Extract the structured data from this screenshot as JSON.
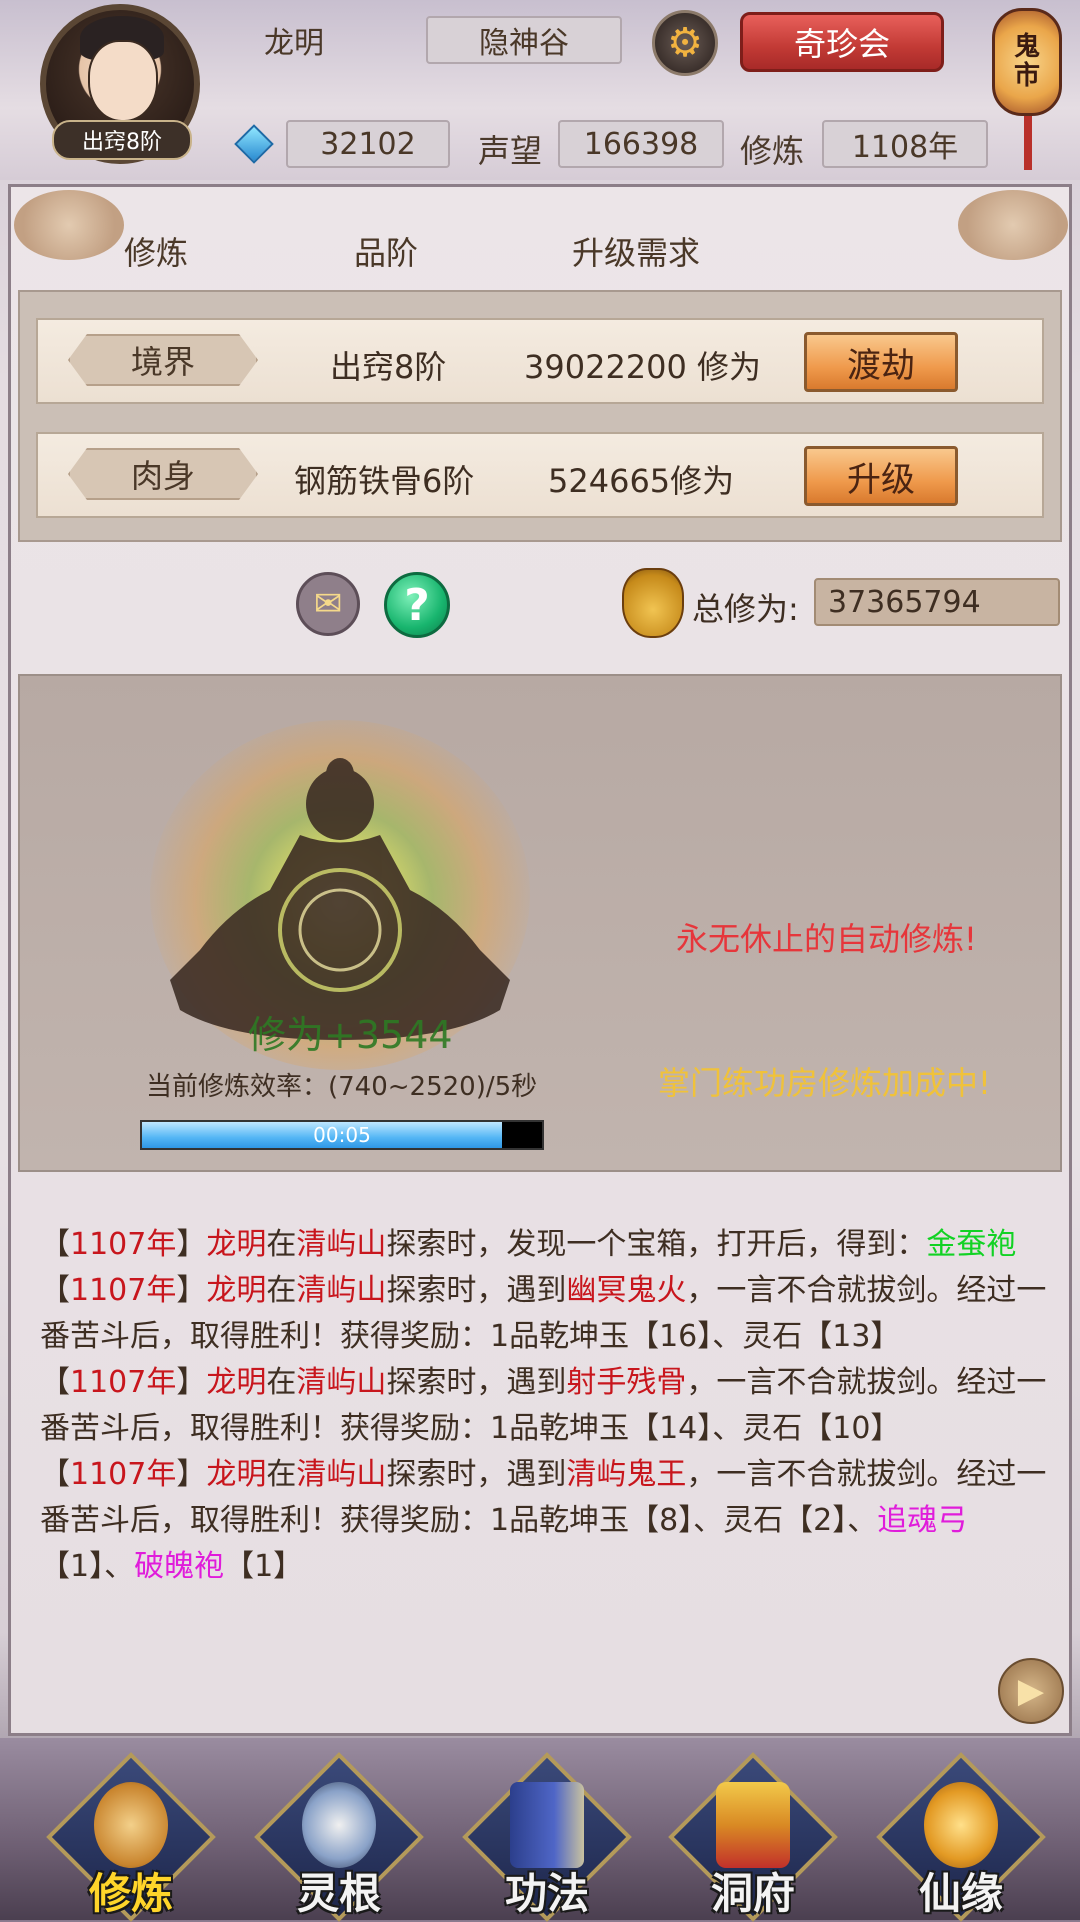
{
  "player": {
    "name": "龙明",
    "realm_badge": "出窍8阶",
    "location": "隐神谷",
    "gems": "32102",
    "fame_label": "声望",
    "fame": "166398",
    "cultivation_label": "修炼",
    "cultivation_years": "1108年"
  },
  "header": {
    "treasure_button": "奇珍会",
    "ghost_market": [
      "鬼",
      "市"
    ]
  },
  "table": {
    "columns": [
      "修炼",
      "品阶",
      "升级需求"
    ],
    "rows": [
      {
        "tag": "境界",
        "level": "出窍8阶",
        "requirement": "39022200 修为",
        "button": "渡劫"
      },
      {
        "tag": "肉身",
        "level": "钢筋铁骨6阶",
        "requirement": "524665修为",
        "button": "升级"
      }
    ]
  },
  "total": {
    "label": "总修为:",
    "value": "37365794"
  },
  "cultivation": {
    "gain_text": "修为+3544",
    "rate_text": "当前修炼效率：(740~2520)/5秒",
    "timer": "00:05",
    "progress": 0.9,
    "auto_text": "永无休止的自动修炼!",
    "sect_text": "掌门练功房修炼加成中!"
  },
  "log": [
    [
      {
        "t": "【",
        "c": ""
      },
      {
        "t": "1107年",
        "c": "red"
      },
      {
        "t": "】",
        "c": ""
      },
      {
        "t": "龙明",
        "c": "red"
      },
      {
        "t": "在",
        "c": ""
      },
      {
        "t": "清屿山",
        "c": "red"
      },
      {
        "t": "探索时，发现一个宝箱，打开后，得到：",
        "c": ""
      },
      {
        "t": "金蚕袍",
        "c": "green"
      }
    ],
    [
      {
        "t": "【",
        "c": ""
      },
      {
        "t": "1107年",
        "c": "red"
      },
      {
        "t": "】",
        "c": ""
      },
      {
        "t": "龙明",
        "c": "red"
      },
      {
        "t": "在",
        "c": ""
      },
      {
        "t": "清屿山",
        "c": "red"
      },
      {
        "t": "探索时，遇到",
        "c": ""
      },
      {
        "t": "幽冥鬼火",
        "c": "red"
      },
      {
        "t": "，一言不合就拔剑。经过一番苦斗后，取得胜利！获得奖励：1品乾坤玉【16】、灵石【13】",
        "c": ""
      }
    ],
    [
      {
        "t": "【",
        "c": ""
      },
      {
        "t": "1107年",
        "c": "red"
      },
      {
        "t": "】",
        "c": ""
      },
      {
        "t": "龙明",
        "c": "red"
      },
      {
        "t": "在",
        "c": ""
      },
      {
        "t": "清屿山",
        "c": "red"
      },
      {
        "t": "探索时，遇到",
        "c": ""
      },
      {
        "t": "射手残骨",
        "c": "red"
      },
      {
        "t": "，一言不合就拔剑。经过一番苦斗后，取得胜利！获得奖励：1品乾坤玉【14】、灵石【10】",
        "c": ""
      }
    ],
    [
      {
        "t": "【",
        "c": ""
      },
      {
        "t": "1107年",
        "c": "red"
      },
      {
        "t": "】",
        "c": ""
      },
      {
        "t": "龙明",
        "c": "red"
      },
      {
        "t": "在",
        "c": ""
      },
      {
        "t": "清屿山",
        "c": "red"
      },
      {
        "t": "探索时，遇到",
        "c": ""
      },
      {
        "t": "清屿鬼王",
        "c": "red"
      },
      {
        "t": "，一言不合就拔剑。经过一番苦斗后，取得胜利！获得奖励：1品乾坤玉【8】、灵石【2】、",
        "c": ""
      },
      {
        "t": "追魂弓",
        "c": "purple"
      },
      {
        "t": "【1】、",
        "c": ""
      },
      {
        "t": "破魄袍",
        "c": "purple"
      },
      {
        "t": "【1】",
        "c": ""
      }
    ]
  ],
  "nav": [
    {
      "label": "修炼",
      "icon": "cultivate-icon",
      "active": true
    },
    {
      "label": "灵根",
      "icon": "spirit-root-icon",
      "active": false
    },
    {
      "label": "功法",
      "icon": "technique-book-icon",
      "active": false
    },
    {
      "label": "洞府",
      "icon": "cave-dwelling-icon",
      "active": false
    },
    {
      "label": "仙缘",
      "icon": "immortal-gourd-icon",
      "active": false
    }
  ],
  "colors": {
    "accent_red": "#c8161d",
    "item_green": "#12d224",
    "item_purple": "#e01cdb",
    "auto_text": "#e6363b",
    "sect_text": "#f0c23a"
  }
}
